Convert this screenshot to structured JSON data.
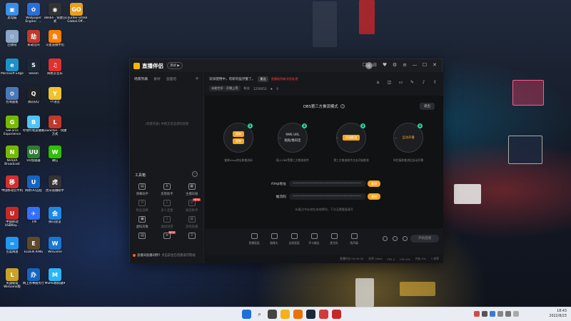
{
  "desktop": {
    "icons": [
      {
        "label": "此电脑",
        "color": "#3a8ee6",
        "glyph": "▣"
      },
      {
        "label": "Wallpaper Engine：...",
        "color": "#2a6fd6",
        "glyph": "✿"
      },
      {
        "label": "obs64 - 快捷方式",
        "color": "#333333",
        "glyph": "◉"
      },
      {
        "label": "Counter-Strike Global Off...",
        "color": "#e8a020",
        "glyph": "GO"
      },
      {
        "label": "回收站",
        "color": "#8aa6c8",
        "glyph": "♲"
      },
      {
        "label": "永劫无间",
        "color": "#c0392b",
        "glyph": "劫"
      },
      {
        "label": "斗鱼直播伴侣",
        "color": "#ff7e00",
        "glyph": "鱼"
      },
      {
        "label": "Microsoft Edge",
        "color": "#1e90c8",
        "glyph": "e"
      },
      {
        "label": "Steam",
        "color": "#1b2838",
        "glyph": "S"
      },
      {
        "label": "网易云音乐",
        "color": "#e03030",
        "glyph": "♫"
      },
      {
        "label": "控制面板",
        "color": "#4a78b8",
        "glyph": "⚙"
      },
      {
        "label": "腾讯QQ",
        "color": "#222222",
        "glyph": "Q"
      },
      {
        "label": "YY语音",
        "color": "#f2c12e",
        "glyph": "Y"
      },
      {
        "label": "GeForce Experience",
        "color": "#76b900",
        "glyph": "G"
      },
      {
        "label": "哔哩哔哩直播姬",
        "color": "#4fc3f7",
        "glyph": "B"
      },
      {
        "label": "Launcher - 快捷方式",
        "color": "#c0392b",
        "glyph": "L"
      },
      {
        "label": "NVIDIA Broadcast",
        "color": "#76b900",
        "glyph": "N"
      },
      {
        "label": "UU加速器",
        "color": "#2e7d32",
        "glyph": "UU"
      },
      {
        "label": "微信",
        "color": "#2dc100",
        "glyph": "W"
      },
      {
        "label": "中国移动云手机",
        "color": "#d32f2f",
        "glyph": "移"
      },
      {
        "label": "网易UU远程",
        "color": "#1565c0",
        "glyph": "U"
      },
      {
        "label": "虎牙直播助手",
        "color": "#333333",
        "glyph": "虎"
      },
      {
        "label": "中国移动USBKey...",
        "color": "#c62828",
        "glyph": "U"
      },
      {
        "label": "飞书",
        "color": "#3370ff",
        "glyph": "✈"
      },
      {
        "label": "腾讯会议",
        "color": "#1e88e5",
        "glyph": "会"
      },
      {
        "label": "百度网盘",
        "color": "#2196f3",
        "glyph": "∞"
      },
      {
        "label": "ELDEN RING",
        "color": "#5d4a2a",
        "glyph": "E"
      },
      {
        "label": "WeGame",
        "color": "#1976d2",
        "glyph": "W"
      },
      {
        "label": "英雄联盟WeGame版",
        "color": "#c9a227",
        "glyph": "L"
      },
      {
        "label": "网上办事服务厅",
        "color": "#1565c0",
        "glyph": "办"
      },
      {
        "label": "MuMu模拟器9",
        "color": "#29b6f6",
        "glyph": "M"
      }
    ]
  },
  "app": {
    "title": "直播伴侣",
    "version": "测试 ▶",
    "window_controls": [
      "☐",
      "⊟",
      "♥",
      "⚙",
      "≡",
      "—",
      "☐",
      "✕"
    ],
    "left": {
      "tabs": [
        "场景列表",
        "素材",
        "画面组"
      ],
      "add": "+",
      "empty_hint": "(场景列表) 中暂无可选择的场景",
      "tools_title": "工具箱",
      "tools_more": "···",
      "tools": [
        {
          "label": "弹幕助手",
          "glyph": "▤",
          "dim": false,
          "new": false
        },
        {
          "label": "房管助手",
          "glyph": "♙",
          "dim": false,
          "new": false
        },
        {
          "label": "主播日报",
          "glyph": "▦",
          "dim": false,
          "new": false
        },
        {
          "label": "粉丝勋章",
          "glyph": "✉",
          "dim": true,
          "new": false
        },
        {
          "label": "多人连麦",
          "glyph": "⇩",
          "dim": true,
          "new": false
        },
        {
          "label": "推流助手",
          "glyph": "⇄",
          "dim": true,
          "new": true
        },
        {
          "label": "虚拟形象",
          "glyph": "▣",
          "dim": false,
          "new": false
        },
        {
          "label": "虚拟场景",
          "glyph": "⇩",
          "dim": true,
          "new": false
        },
        {
          "label": "游戏直播",
          "glyph": "▦",
          "dim": true,
          "new": false
        },
        {
          "label": "",
          "glyph": "▤",
          "dim": false,
          "new": false
        },
        {
          "label": "",
          "glyph": "≋",
          "dim": false,
          "new": true
        },
        {
          "label": "",
          "glyph": "⇩",
          "dim": false,
          "new": false
        }
      ],
      "notice": "直播间直播间特?",
      "notice_hint": "点击前往已创建或可帮助"
    },
    "main": {
      "welcome": "双排使用中，有新的猛然警了。",
      "welcome_tag": "重连",
      "welcome_warn": "直播收到新消息处理",
      "stats": {
        "chip": "未能完毕 · 开播上等",
        "fans_label": "粉丝",
        "fans": "1250053",
        "likes": "0"
      },
      "icons": [
        "⌂",
        "◫",
        "▭",
        "✎",
        "♪",
        "⇪"
      ]
    },
    "obs": {
      "title": "OBS第三方推流模式",
      "help": "?",
      "exit": "退出",
      "steps": [
        {
          "num": "1",
          "kind": "pills",
          "pill1": "复制",
          "pill2": "复制",
          "desc": "复制rtmp地址和推流码"
        },
        {
          "num": "2",
          "kind": "text",
          "line1": "RMS URL",
          "line2": "粘贴/推码连",
          "desc": "填入OBS等第三方推流软件"
        },
        {
          "num": "3",
          "kind": "pill",
          "pill1": "开始推流",
          "desc": "第三方推流软件点击开始推流"
        },
        {
          "num": "4",
          "kind": "gold",
          "line1": "自动开播",
          "desc": "伴侣接收推流后自动开播"
        }
      ],
      "arrow": "»",
      "rtmp_label": "rtmp地址",
      "rtmp_value": "**********************************************",
      "key_label": "推流码",
      "key_value": "**********************************************",
      "copy": "复制",
      "footnote": "未通过rtmp地址有效期时，下次无需重复填写"
    },
    "controls": {
      "items": [
        "直播画面",
        "摄像头",
        "全屏画面",
        "声卡输出",
        "麦克风",
        "扬声器"
      ],
      "start": "开始直播"
    },
    "status": [
      "直播时长 00:00:00",
      "码率 0kb/s",
      "FPS 0",
      "CPU 0%",
      "内存 0%",
      "1 帧率"
    ]
  },
  "taskbar": {
    "time": "18:43",
    "date": "2022/8/23"
  }
}
